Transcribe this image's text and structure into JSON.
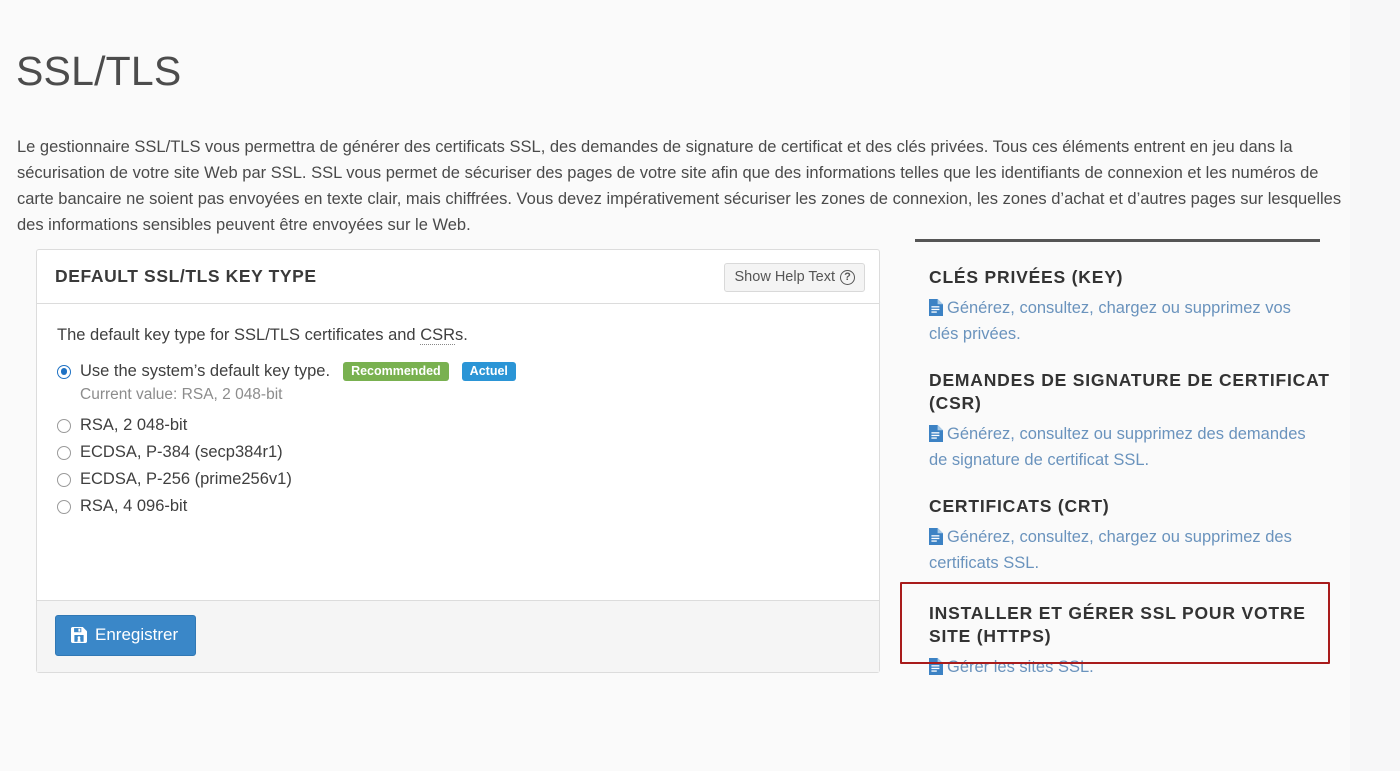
{
  "page": {
    "title": "SSL/TLS",
    "intro": "Le gestionnaire SSL/TLS vous permettra de générer des certificats SSL, des demandes de signature de certificat et des clés privées. Tous ces éléments entrent en jeu dans la sécurisation de votre site Web par SSL. SSL vous permet de sécuriser des pages de votre site afin que des informations telles que les identifiants de connexion et les numéros de carte bancaire ne soient pas envoyées en texte clair, mais chiffrées. Vous devez impérativement sécuriser les zones de connexion, les zones d’achat et d’autres pages sur lesquelles des informations sensibles peuvent être envoyées sur le Web."
  },
  "card": {
    "header_title": "DEFAULT SSL/TLS KEY TYPE",
    "help_button_label": "Show Help Text",
    "help_icon": "question-circle-icon",
    "description_pre": "The default key type for SSL/TLS certificates and ",
    "description_abbr": "CSR",
    "description_post": "s.",
    "options": [
      {
        "label": "Use the system’s default key type.",
        "selected": true,
        "badges": [
          {
            "text": "Recommended",
            "color": "#79b150"
          },
          {
            "text": "Actuel",
            "color": "#2b95d6"
          }
        ],
        "note": "Current value: RSA, 2 048-bit"
      },
      {
        "label": "RSA, 2 048-bit",
        "selected": false,
        "badges": [],
        "note": ""
      },
      {
        "label": "ECDSA, P-384 (secp384r1)",
        "selected": false,
        "badges": [],
        "note": ""
      },
      {
        "label": "ECDSA, P-256 (prime256v1)",
        "selected": false,
        "badges": [],
        "note": ""
      },
      {
        "label": "RSA, 4 096-bit",
        "selected": false,
        "badges": [],
        "note": ""
      }
    ],
    "save_label": "Enregistrer",
    "save_icon": "save-floppy-icon"
  },
  "sidebar": {
    "sections": [
      {
        "heading": "CLÉS PRIVÉES (KEY)",
        "link": "Générez, consultez, chargez ou supprimez vos clés privées.",
        "icon": "document-icon",
        "highlighted": false
      },
      {
        "heading": "DEMANDES DE SIGNATURE DE CERTIFICAT (CSR)",
        "link": "Générez, consultez ou supprimez des demandes de signature de certificat SSL.",
        "icon": "document-icon",
        "highlighted": false
      },
      {
        "heading": "CERTIFICATS (CRT)",
        "link": "Générez, consultez, chargez ou supprimez des certificats SSL.",
        "icon": "document-icon",
        "highlighted": true
      },
      {
        "heading": "INSTALLER ET GÉRER SSL POUR VOTRE SITE (HTTPS)",
        "link": "Gérer les sites SSL.",
        "icon": "document-icon",
        "highlighted": false
      }
    ]
  },
  "annotation": {
    "highlight_color": "#a81b1b"
  }
}
